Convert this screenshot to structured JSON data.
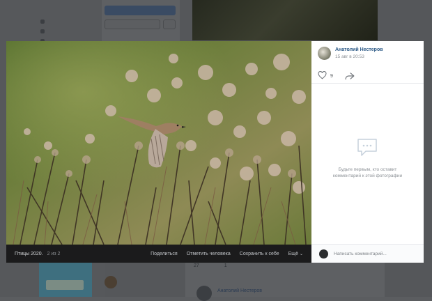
{
  "viewer": {
    "album": "Птицы 2020.",
    "counter": "2 из 2",
    "actions": {
      "share": "Поделиться",
      "tag": "Отметить человека",
      "save": "Сохранить к себе",
      "more": "Ещё"
    }
  },
  "post": {
    "author": "Анатолий Нестеров",
    "date": "15 авг в 20:53",
    "likes": "9"
  },
  "comments": {
    "empty_line1": "Будьте первым, кто оставит",
    "empty_line2": "комментарий к этой фотографии",
    "placeholder": "Написать комментарий..."
  },
  "background": {
    "feed_counts": [
      "27",
      "",
      "1"
    ],
    "feed_author": "Анатолий Нестеров"
  },
  "icons": [
    "heart-icon",
    "share-arrow-icon",
    "comments-empty-icon",
    "chevron-down-icon"
  ],
  "colors": {
    "link": "#2a5885",
    "photo_bar": "#1b1b1c",
    "overlay": "#55575a"
  }
}
